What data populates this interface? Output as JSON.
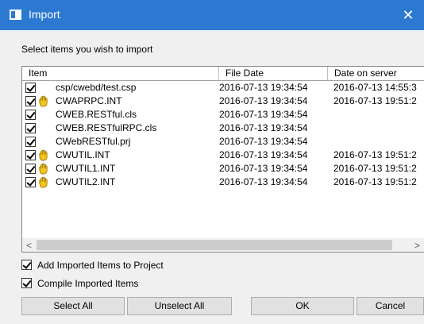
{
  "window": {
    "title": "Import",
    "close_glyph": "✕",
    "icon": "window-icon"
  },
  "instruction": "Select items you wish to import",
  "list": {
    "columns": [
      "Item",
      "File Date",
      "Date on server"
    ],
    "rows": [
      {
        "name": "csp/cwebd/test.csp",
        "checked": true,
        "hand": false,
        "file_date": "2016-07-13 19:34:54",
        "server_date": "2016-07-13 14:55:3"
      },
      {
        "name": "CWAPRPC.INT",
        "checked": true,
        "hand": true,
        "file_date": "2016-07-13 19:34:54",
        "server_date": "2016-07-13 19:51:2"
      },
      {
        "name": "CWEB.RESTful.cls",
        "checked": true,
        "hand": false,
        "file_date": "2016-07-13 19:34:54",
        "server_date": ""
      },
      {
        "name": "CWEB.RESTfulRPC.cls",
        "checked": true,
        "hand": false,
        "file_date": "2016-07-13 19:34:54",
        "server_date": ""
      },
      {
        "name": "CWebRESTful.prj",
        "checked": true,
        "hand": false,
        "file_date": "2016-07-13 19:34:54",
        "server_date": ""
      },
      {
        "name": "CWUTIL.INT",
        "checked": true,
        "hand": true,
        "file_date": "2016-07-13 19:34:54",
        "server_date": "2016-07-13 19:51:2"
      },
      {
        "name": "CWUTIL1.INT",
        "checked": true,
        "hand": true,
        "file_date": "2016-07-13 19:34:54",
        "server_date": "2016-07-13 19:51:2"
      },
      {
        "name": "CWUTIL2.INT",
        "checked": true,
        "hand": true,
        "file_date": "2016-07-13 19:34:54",
        "server_date": "2016-07-13 19:51:2"
      }
    ],
    "scroll_left": "<",
    "scroll_right": ">"
  },
  "options": {
    "add_to_project": {
      "label": "Add Imported Items to Project",
      "checked": true
    },
    "compile": {
      "label": "Compile Imported Items",
      "checked": true
    }
  },
  "buttons": {
    "select_all": "Select All",
    "unselect_all": "Unselect All",
    "ok": "OK",
    "cancel": "Cancel"
  },
  "colors": {
    "titlebar": "#2b79d0",
    "hand_fill": "#f5c518",
    "hand_stroke": "#8a6a00"
  }
}
